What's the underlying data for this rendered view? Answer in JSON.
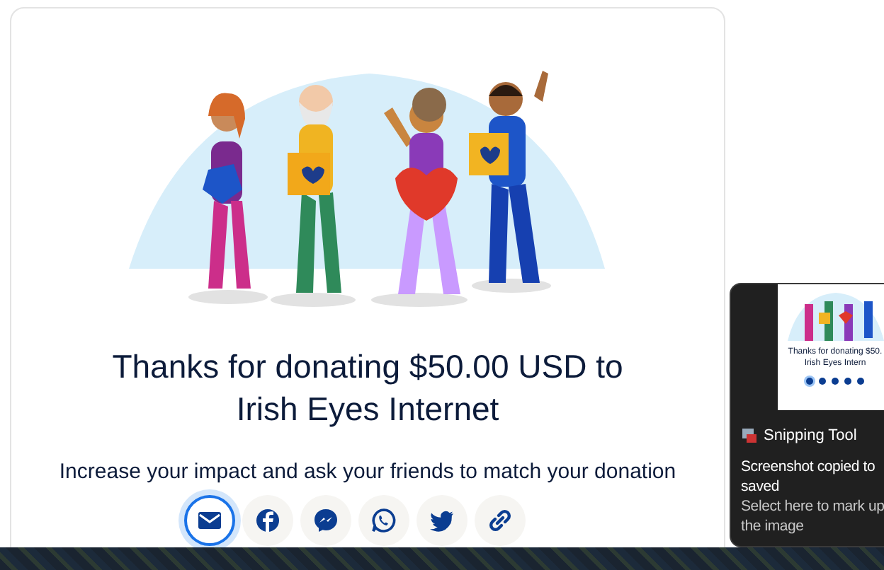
{
  "heading_lines": [
    "Thanks for donating $50.00 USD to",
    "Irish Eyes Internet"
  ],
  "subtitle": "Increase your impact and ask your friends to match your donation",
  "share_buttons": [
    {
      "kind": "email",
      "selected": true
    },
    {
      "kind": "facebook",
      "selected": false
    },
    {
      "kind": "messenger",
      "selected": false
    },
    {
      "kind": "whatsapp",
      "selected": false
    },
    {
      "kind": "twitter",
      "selected": false
    },
    {
      "kind": "link",
      "selected": false
    }
  ],
  "notification": {
    "app": "Snipping Tool",
    "thumbnail_lines": [
      "Thanks for donating $50.",
      "Irish Eyes Intern"
    ],
    "message_lines": [
      "Screenshot copied to",
      "saved"
    ],
    "hint_lines": [
      "Select here to mark up",
      "the image"
    ]
  }
}
